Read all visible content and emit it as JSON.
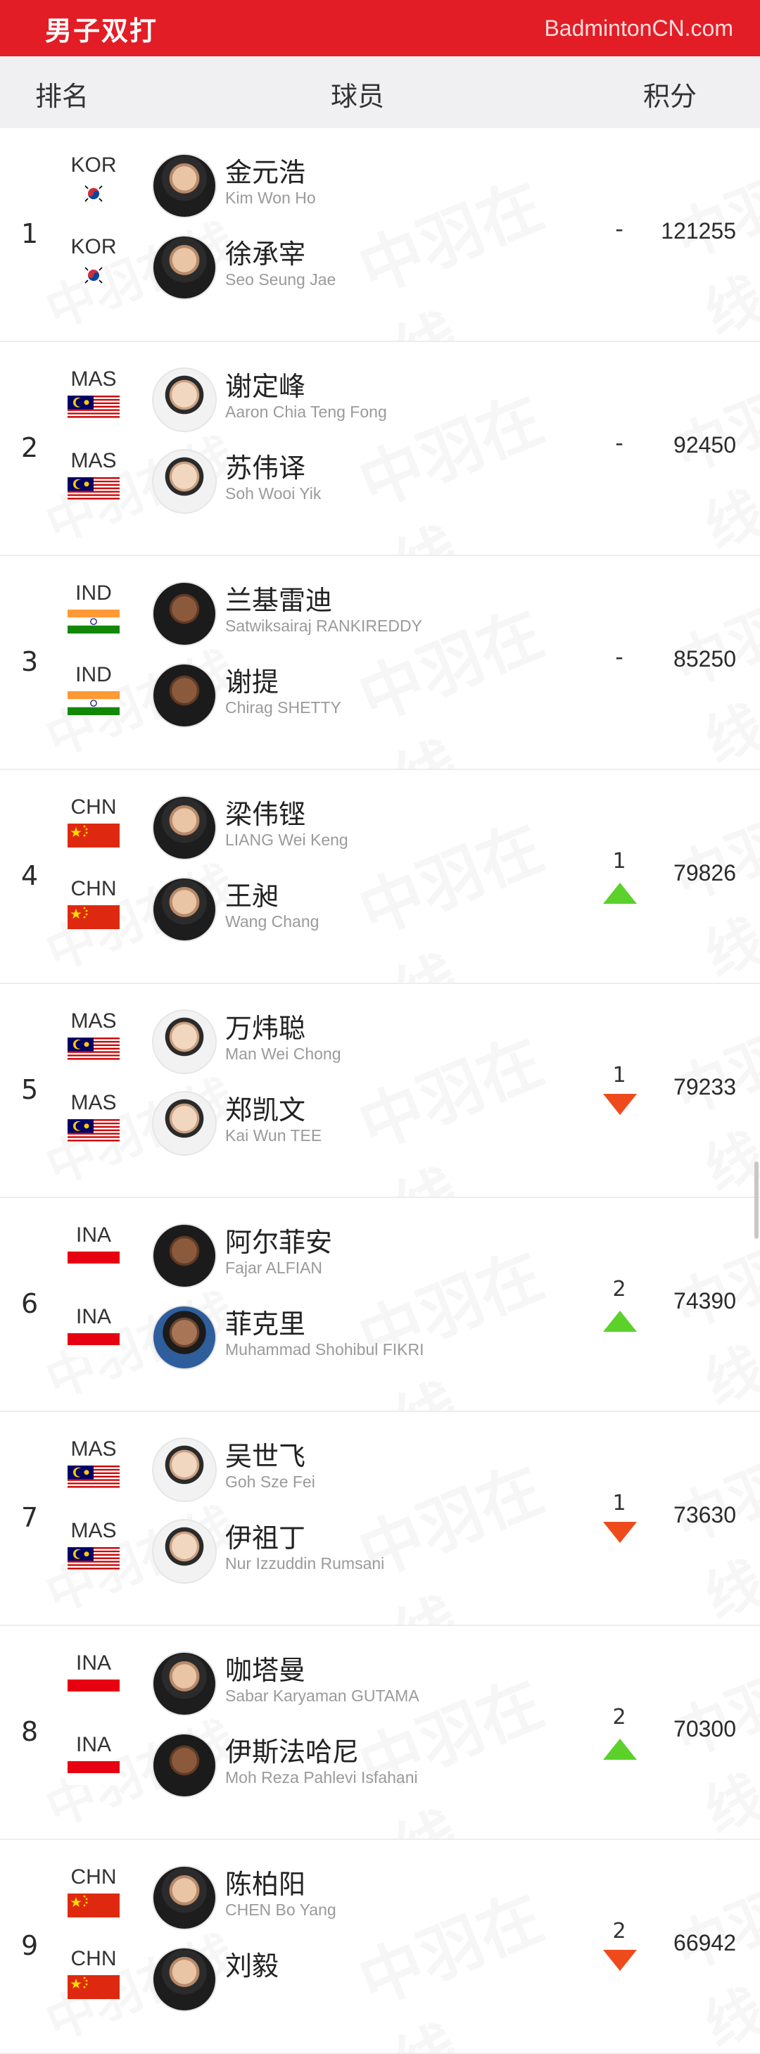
{
  "header": {
    "title": "男子双打",
    "brand": "BadmintonCN.com"
  },
  "columns": {
    "rank": "排名",
    "player": "球员",
    "points": "积分"
  },
  "watermark": "中羽在线",
  "colors": {
    "accent": "#e21d26",
    "up": "#5bd12a",
    "down": "#ef4a1c"
  },
  "rows": [
    {
      "rank": "1",
      "change": "-",
      "trend": "flat",
      "points": "121255",
      "players": [
        {
          "country": "KOR",
          "flag": "korea-flag",
          "cn": "金元浩",
          "en": "Kim Won Ho",
          "avatar": "default"
        },
        {
          "country": "KOR",
          "flag": "korea-flag",
          "cn": "徐承宰",
          "en": "Seo Seung Jae",
          "avatar": "default"
        }
      ]
    },
    {
      "rank": "2",
      "change": "-",
      "trend": "flat",
      "points": "92450",
      "players": [
        {
          "country": "MAS",
          "flag": "malaysia-flag",
          "cn": "谢定峰",
          "en": "Aaron Chia Teng Fong",
          "avatar": "light"
        },
        {
          "country": "MAS",
          "flag": "malaysia-flag",
          "cn": "苏伟译",
          "en": "Soh Wooi Yik",
          "avatar": "light"
        }
      ]
    },
    {
      "rank": "3",
      "change": "-",
      "trend": "flat",
      "points": "85250",
      "players": [
        {
          "country": "IND",
          "flag": "india-flag",
          "cn": "兰基雷迪",
          "en": "Satwiksairaj RANKIREDDY",
          "avatar": "dark"
        },
        {
          "country": "IND",
          "flag": "india-flag",
          "cn": "谢提",
          "en": "Chirag SHETTY",
          "avatar": "dark"
        }
      ]
    },
    {
      "rank": "4",
      "change": "1",
      "trend": "up",
      "points": "79826",
      "players": [
        {
          "country": "CHN",
          "flag": "china-flag",
          "cn": "梁伟铿",
          "en": "LIANG Wei Keng",
          "avatar": "default"
        },
        {
          "country": "CHN",
          "flag": "china-flag",
          "cn": "王昶",
          "en": "Wang Chang",
          "avatar": "default"
        }
      ]
    },
    {
      "rank": "5",
      "change": "1",
      "trend": "down",
      "points": "79233",
      "players": [
        {
          "country": "MAS",
          "flag": "malaysia-flag",
          "cn": "万炜聪",
          "en": "Man Wei Chong",
          "avatar": "light"
        },
        {
          "country": "MAS",
          "flag": "malaysia-flag",
          "cn": "郑凯文",
          "en": "Kai Wun TEE",
          "avatar": "light"
        }
      ]
    },
    {
      "rank": "6",
      "change": "2",
      "trend": "up",
      "points": "74390",
      "players": [
        {
          "country": "INA",
          "flag": "indonesia-flag",
          "cn": "阿尔菲安",
          "en": "Fajar ALFIAN",
          "avatar": "dark"
        },
        {
          "country": "INA",
          "flag": "indonesia-flag",
          "cn": "菲克里",
          "en": "Muhammad Shohibul FIKRI",
          "avatar": "blue"
        }
      ]
    },
    {
      "rank": "7",
      "change": "1",
      "trend": "down",
      "points": "73630",
      "players": [
        {
          "country": "MAS",
          "flag": "malaysia-flag",
          "cn": "吴世飞",
          "en": "Goh Sze Fei",
          "avatar": "light"
        },
        {
          "country": "MAS",
          "flag": "malaysia-flag",
          "cn": "伊祖丁",
          "en": "Nur Izzuddin Rumsani",
          "avatar": "light"
        }
      ]
    },
    {
      "rank": "8",
      "change": "2",
      "trend": "up",
      "points": "70300",
      "players": [
        {
          "country": "INA",
          "flag": "indonesia-flag",
          "cn": "咖塔曼",
          "en": "Sabar Karyaman GUTAMA",
          "avatar": "default"
        },
        {
          "country": "INA",
          "flag": "indonesia-flag",
          "cn": "伊斯法哈尼",
          "en": "Moh Reza Pahlevi Isfahani",
          "avatar": "dark"
        }
      ]
    },
    {
      "rank": "9",
      "change": "2",
      "trend": "down",
      "points": "66942",
      "players": [
        {
          "country": "CHN",
          "flag": "china-flag",
          "cn": "陈柏阳",
          "en": "CHEN Bo Yang",
          "avatar": "default"
        },
        {
          "country": "CHN",
          "flag": "china-flag",
          "cn": "刘毅",
          "en": "",
          "avatar": "default"
        }
      ]
    }
  ]
}
